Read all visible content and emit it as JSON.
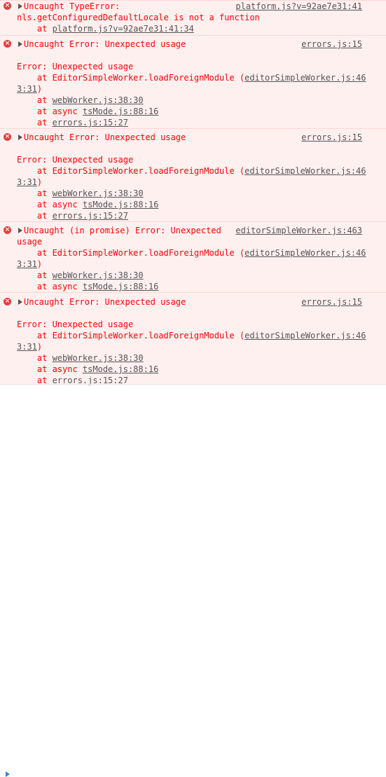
{
  "entries": [
    {
      "header_lines": [
        "Uncaught TypeError:",
        "nls.getConfiguredDefaultLocale is not a function"
      ],
      "source": "platform.js?v=92ae7e31:41",
      "stack": [
        {
          "prefix": "    at ",
          "link": "platform.js?v=92ae7e31:41:34",
          "suffix": ""
        }
      ]
    },
    {
      "header_lines": [
        "Uncaught Error: Unexpected usage"
      ],
      "source": "errors.js:15",
      "message": "Error: Unexpected usage",
      "stack": [
        {
          "prefix": "    at EditorSimpleWorker.loadForeignModule (",
          "link": "editorSimpleWorker.js:46",
          "suffix": ""
        },
        {
          "prefix": "",
          "link": "3:31",
          "suffix": ")"
        },
        {
          "prefix": "    at ",
          "link": "webWorker.js:38:30",
          "suffix": ""
        },
        {
          "prefix": "    at async ",
          "link": "tsMode.js:88:16",
          "suffix": ""
        },
        {
          "prefix": "    at ",
          "link": "errors.js:15:27",
          "suffix": ""
        }
      ]
    },
    {
      "header_lines": [
        "Uncaught Error: Unexpected usage"
      ],
      "source": "errors.js:15",
      "message": "Error: Unexpected usage",
      "stack": [
        {
          "prefix": "    at EditorSimpleWorker.loadForeignModule (",
          "link": "editorSimpleWorker.js:46",
          "suffix": ""
        },
        {
          "prefix": "",
          "link": "3:31",
          "suffix": ")"
        },
        {
          "prefix": "    at ",
          "link": "webWorker.js:38:30",
          "suffix": ""
        },
        {
          "prefix": "    at async ",
          "link": "tsMode.js:88:16",
          "suffix": ""
        },
        {
          "prefix": "    at ",
          "link": "errors.js:15:27",
          "suffix": ""
        }
      ]
    },
    {
      "header_lines": [
        "Uncaught (in promise) Error: Unexpected",
        "usage"
      ],
      "source": "editorSimpleWorker.js:463",
      "stack": [
        {
          "prefix": "    at EditorSimpleWorker.loadForeignModule (",
          "link": "editorSimpleWorker.js:46",
          "suffix": ""
        },
        {
          "prefix": "",
          "link": "3:31",
          "suffix": ")"
        },
        {
          "prefix": "    at ",
          "link": "webWorker.js:38:30",
          "suffix": ""
        },
        {
          "prefix": "    at async ",
          "link": "tsMode.js:88:16",
          "suffix": ""
        }
      ]
    },
    {
      "header_lines": [
        "Uncaught Error: Unexpected usage"
      ],
      "source": "errors.js:15",
      "message": "Error: Unexpected usage",
      "stack": [
        {
          "prefix": "    at EditorSimpleWorker.loadForeignModule (",
          "link": "editorSimpleWorker.js:46",
          "suffix": ""
        },
        {
          "prefix": "",
          "link": "3:31",
          "suffix": ")"
        },
        {
          "prefix": "    at ",
          "link": "webWorker.js:38:30",
          "suffix": ""
        },
        {
          "prefix": "    at async ",
          "link": "tsMode.js:88:16",
          "suffix": ""
        },
        {
          "prefix": "    at ",
          "link": "errors.js:15:27",
          "suffix": ""
        }
      ]
    }
  ],
  "icons": {
    "error": "error-circle-icon",
    "expand": "expand-triangle-icon",
    "prompt": "console-prompt-icon"
  },
  "colors": {
    "error_text": "#ff0000",
    "error_bg": "#fff0f0",
    "link": "#545454",
    "prompt": "#3b7fd6"
  }
}
